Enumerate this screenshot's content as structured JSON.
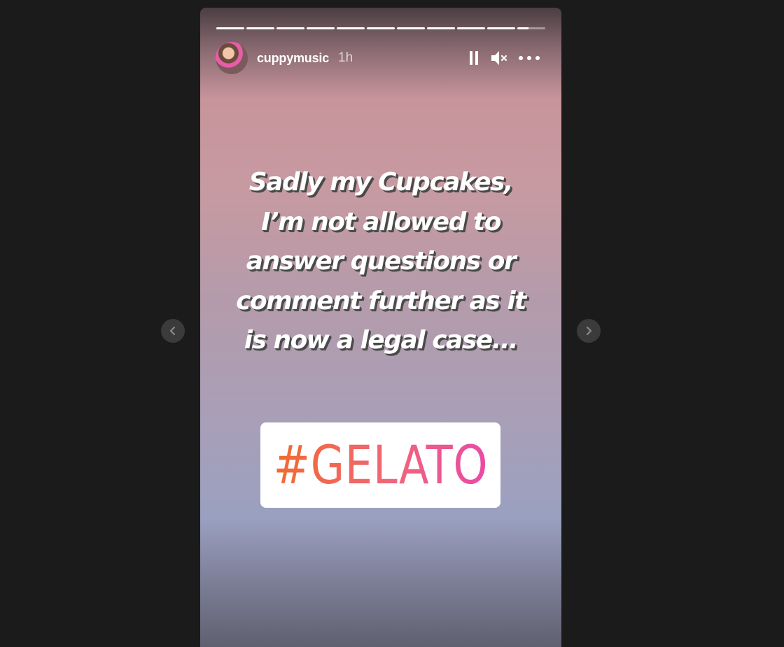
{
  "story": {
    "progress_segments": 11,
    "active_segment_progress": 0.4,
    "username": "cuppymusic",
    "time": "1h",
    "caption_lines": [
      "Sadly my Cupcakes,",
      "I’m not allowed to",
      "answer questions or",
      "comment further as it",
      "is now a legal case..."
    ],
    "sticker": "#GELATO"
  },
  "icons": {
    "pause": "pause-icon",
    "mute": "muted-speaker-icon",
    "more": "more-options-icon",
    "prev": "chevron-left-icon",
    "next": "chevron-right-icon"
  },
  "colors": {
    "page_background": "#1b1b1b",
    "sticker_gradient_start": "#f26a2e",
    "sticker_gradient_end": "#e94aa6"
  }
}
